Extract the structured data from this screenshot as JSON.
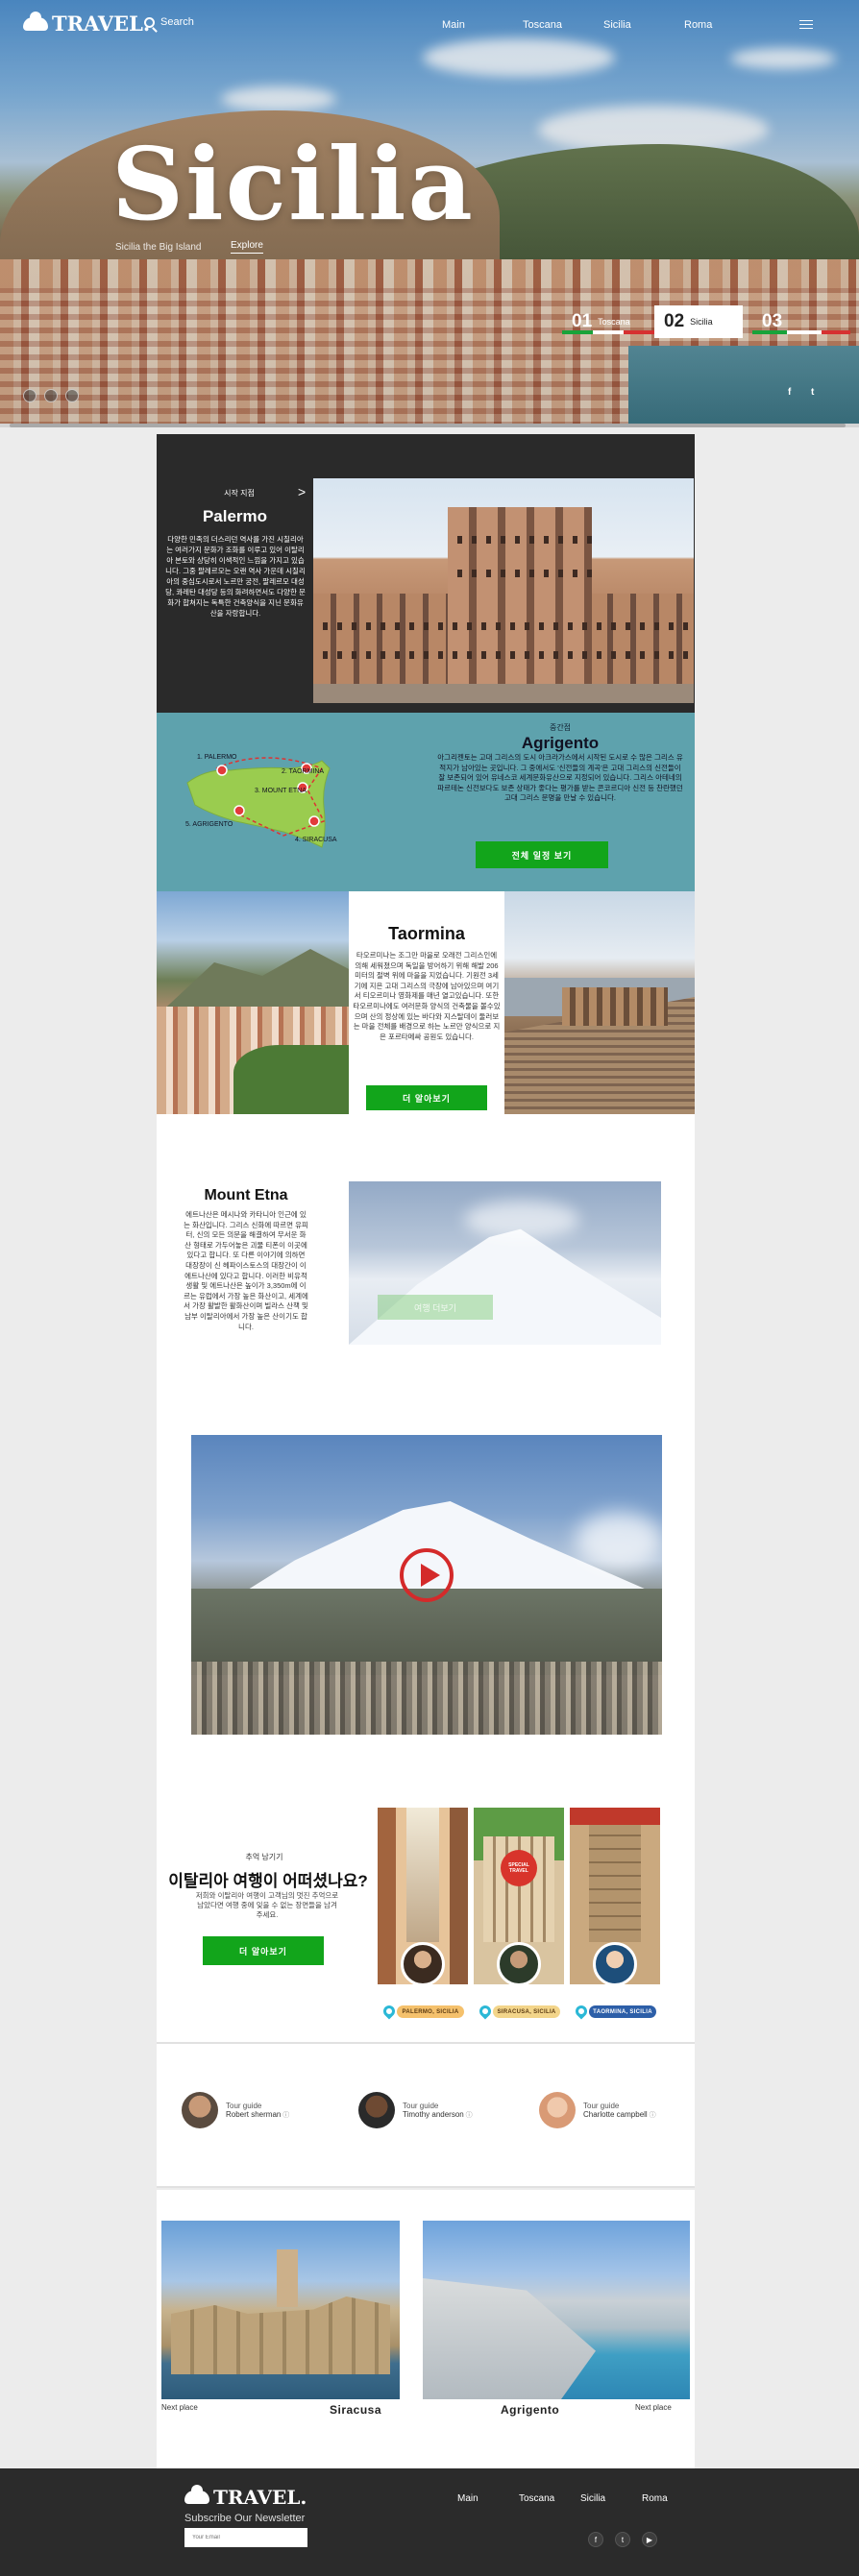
{
  "nav": {
    "logo": "TRAVEL.",
    "search_label": "Search",
    "links": [
      "Main",
      "Toscana",
      "Sicilia",
      "Roma"
    ]
  },
  "hero": {
    "title": "Sicilia",
    "subtitle": "Sicilia the Big Island",
    "explore": "Explore",
    "slides": [
      {
        "num": "01",
        "label": "Toscana"
      },
      {
        "num": "02",
        "label": "Sicilia"
      },
      {
        "num": "03",
        "label": ""
      }
    ],
    "social": [
      "f",
      "t"
    ]
  },
  "palermo": {
    "kicker": "시작 지점",
    "title": "Palermo",
    "body": "다양한 민족의 더스리던 역사를 가진 시칠리아는 여러가지 문화가 조화를 이루고 있어 이탈리아 본토와 상당히 이색적인 느낌을 가지고 있습니다. 그중 팔레르모는 오랜 역사 가운데 시칠리아의 중심도시로서 노르만 궁전, 팔레르모 대성당, 콰레탄 대성당 등의 화려하면서도 다양한 문화가 합쳐지는 독특한 건축양식을 지닌 문화유산을 자랑합니다."
  },
  "agrigento": {
    "kicker": "중간점",
    "title": "Agrigento",
    "body": "아그리젠토는 고대 그리스의 도시 아크라가스에서 시작된 도시로 수 많은 그리스 유적지가 남아있는 곳입니다. 그 중에서도 '신전들의 계곡'은 고대 그리스의 신전들이 잘 보존되어 있어 유네스코 세계문화유산으로 지정되어 있습니다. 그리스 아테네의 파르테논 신전보다도 보존 상태가 좋다는 평가를 받는 콘코르디아 신전 등 찬란했던 고대 그리스 문명을 만날 수 있습니다.",
    "button": "전체 일정 보기",
    "map_stops": [
      "1. PALERMO",
      "2. TAORMINA",
      "3. MOUNT ETNA",
      "4. SIRACUSA",
      "5. AGRIGENTO"
    ]
  },
  "taormina": {
    "title": "Taormina",
    "body": "타오르미나는 조그만 마을로 오래전 그리스인에 의해 세워졌으며 독일을 방어하기 위해 해발 206미터의 절벽 위에 마을을 지었습니다. 기원전 3세기에 지은 고대 그리스의 극장에 남아있으며 여기서 티오르미나 영화제를 매년 열고있습니다. 또한 타오르미나에도 여러문화 양식의 건축물을 볼수있으며 산의 정상에 있는 바다와 지스탈데이 둘러보는 마을 전체를 배경으로 하는 노르만 양식으로 지은 포르타메싸 공원도 있습니다.",
    "button": "더 알아보기"
  },
  "etna": {
    "title": "Mount Etna",
    "body": "에트나산은 메시나와 카타니아 인근에 있는 화산입니다. 그리스 신화에 따르면 유피터, 신의 모든 의문을 해결하여 무서운 화산 형태로 가두어놓은 괴물 티폰이 이곳에 있다고 합니다. 또 다른 이야기에 의하면 대장장이 신 헤파이스토스의 대장간이 이 에트나산에 있다고 합니다. 이러한 비유적 생활 및 에트나산은 높이가 3,350m에 이르는 유럽에서 가장 높은 화산이고, 세계에서 가장 활발한 활화산이며 빌라스 산책 및 남부 이탈리아에서 가장 높은 산이기도 합니다.",
    "ghost_button": "여행 더보기"
  },
  "experience": {
    "kicker": "추억 남기기",
    "title": "이탈리아 여행이 어떠셨나요?",
    "body": "저희와 이탈리아 여행이 고객님의 멋진 추억으로 남았다면 여행 중에 잊을 수 없는 장면들을 남겨주세요.",
    "button": "더 알아보기",
    "cards": [
      {
        "label": "PALERMO, SICILIA"
      },
      {
        "label": "SIRACUSA, SICILIA",
        "badge": "SPECIAL TRAVEL"
      },
      {
        "label": "TAORMINA, SICILIA"
      }
    ]
  },
  "guides": [
    {
      "role": "Tour guide",
      "name": "Robert sherman"
    },
    {
      "role": "Tour guide",
      "name": "Timothy anderson"
    },
    {
      "role": "Tour guide",
      "name": "Charlotte campbell"
    }
  ],
  "next": {
    "left_label": "Next place",
    "left_place": "Siracusa",
    "right_place": "Agrigento",
    "right_label": "Next place"
  },
  "footer": {
    "logo": "TRAVEL.",
    "subscribe": "Subscribe Our Newsletter",
    "email_placeholder": "Your Email",
    "links": [
      "Main",
      "Toscana",
      "Sicilia",
      "Roma"
    ],
    "social": [
      "f",
      "t",
      "▶"
    ]
  },
  "colors": {
    "green": "#12a51b",
    "teal": "#5ea2ad",
    "dark": "#2a2a2a",
    "pin": "#2bb8d6"
  }
}
